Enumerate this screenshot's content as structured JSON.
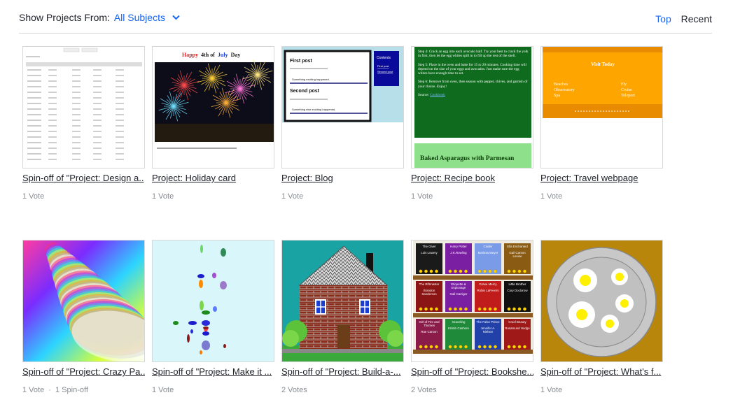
{
  "header": {
    "filter_label": "Show Projects From:",
    "filter_value": "All Subjects",
    "sort_top": "Top",
    "sort_recent": "Recent"
  },
  "projects": [
    {
      "title": "Spin-off of \"Project: Design a..",
      "votes": "1 Vote"
    },
    {
      "title": "Project: Holiday card",
      "votes": "1 Vote"
    },
    {
      "title": "Project: Blog",
      "votes": "1 Vote"
    },
    {
      "title": "Project: Recipe book",
      "votes": "1 Vote"
    },
    {
      "title": "Project: Travel webpage",
      "votes": "1 Vote"
    },
    {
      "title": "Spin-off of \"Project: Crazy Pa..",
      "votes": "1 Vote",
      "spinoffs": "1 Spin-off"
    },
    {
      "title": "Spin-off of \"Project: Make it ...",
      "votes": "1 Vote"
    },
    {
      "title": "Spin-off of \"Project: Build-a-...",
      "votes": "2 Votes"
    },
    {
      "title": "Spin-off of \"Project: Bookshe...",
      "votes": "2 Votes"
    },
    {
      "title": "Spin-off of \"Project: What's f...",
      "votes": "1 Vote"
    }
  ],
  "thumb_text": {
    "holiday": {
      "w1": "Happy",
      "w2": "4th of",
      "w3": "July",
      "w4": "Day"
    },
    "blog": {
      "post1": "First post",
      "post2": "Second post",
      "line1": "Something exciting happened.",
      "line2": "Something else exciting happened.",
      "contents": "Contents",
      "link1": "First post",
      "link2": "Second post"
    },
    "recipe": {
      "step4": "Step 4: Crack an egg into each avocado half. Try your best to crack the yolk in first, then let the egg whites spill in to fill up the rest of the shell.",
      "step5": "Step 5: Place in the oven and bake for 15 to 20 minutes. Cooking time will depend on the size of your eggs and avocados. Just make sure the egg whites have enough time to set.",
      "step6": "Step 6: Remove from oven, then season with pepper, chives, and garnish of your choice. Enjoy!",
      "source": "Source:",
      "source_link": "Cookbook",
      "footer": "Baked Asparagus with Parmesan"
    },
    "travel": {
      "title": "Visit Today",
      "col1": [
        "Beaches",
        "Observatory",
        "Spa"
      ],
      "col2": [
        "Fly",
        "Cruise",
        "Teleport"
      ]
    },
    "books": [
      {
        "t": "The Giver",
        "a": "Lois Lowery",
        "c": "#1a1a1a"
      },
      {
        "t": "Harry Potter",
        "a": "J.K.Rowling",
        "c": "#7a1fa2"
      },
      {
        "t": "Cinder",
        "a": "Marissa Meyer",
        "c": "#7a9be8"
      },
      {
        "t": "Ella Enchanted",
        "a": "Gail Carson Levine",
        "c": "#8a5b12"
      },
      {
        "t": "The Riftmaster",
        "a": "Brandon Sanderson",
        "c": "#8b1414"
      },
      {
        "t": "Etiquette & Espionage",
        "a": "Gail Carriger",
        "c": "#7a1fa2"
      },
      {
        "t": "Grave Mercy",
        "a": "Robin LaFevers",
        "c": "#c01c1c"
      },
      {
        "t": "Little Brother",
        "a": "Cory Doctorow",
        "c": "#111111"
      },
      {
        "t": "Girl of Fire and Thornes",
        "a": "Rae Carson",
        "c": "#8b1c4a"
      },
      {
        "t": "Graceling",
        "a": "Kristin Cashore",
        "c": "#1f8a3a"
      },
      {
        "t": "The False Prince",
        "a": "Jennifer A. Nielsen",
        "c": "#2141a8"
      },
      {
        "t": "Cruel Beauty",
        "a": "Rosamund Hodge",
        "c": "#a01919"
      }
    ]
  },
  "colors": {
    "accent": "#1865f2",
    "text": "#21242c",
    "muted": "#888d93",
    "divider": "#d6d8da"
  }
}
